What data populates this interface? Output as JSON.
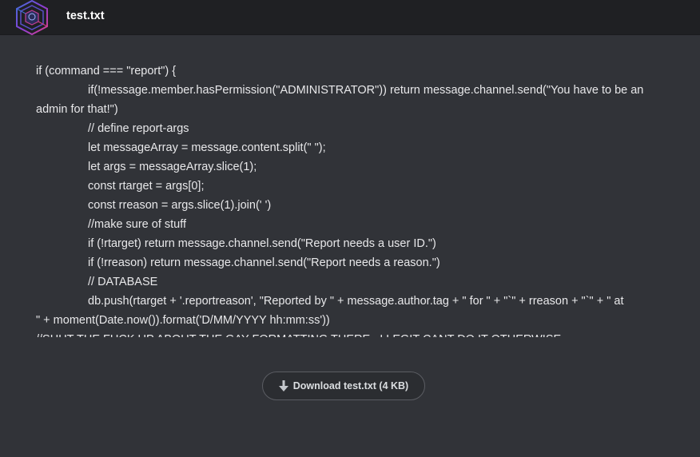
{
  "header": {
    "title": "test.txt",
    "logo_icon": "hexagon-cube-logo"
  },
  "file": {
    "lines": [
      {
        "text": "if (command === \"report\") {",
        "indent": false
      },
      {
        "text": "if(!message.member.hasPermission(\"ADMINISTRATOR\")) return message.channel.send(\"You have to be an",
        "indent": true
      },
      {
        "text": "admin for that!\")",
        "indent": false
      },
      {
        "text": "// define report-args",
        "indent": true
      },
      {
        "text": "let messageArray = message.content.split(\" \");",
        "indent": true
      },
      {
        "text": "let args = messageArray.slice(1);",
        "indent": true
      },
      {
        "text": "const rtarget = args[0];",
        "indent": true
      },
      {
        "text": "const rreason = args.slice(1).join(' ')",
        "indent": true
      },
      {
        "text": "//make sure of stuff",
        "indent": true
      },
      {
        "text": "if (!rtarget) return message.channel.send(\"Report needs a user ID.\")",
        "indent": true
      },
      {
        "text": "if (!rreason) return message.channel.send(\"Report needs a reason.\")",
        "indent": true
      },
      {
        "text": "// DATABASE",
        "indent": true
      },
      {
        "text": "db.push(rtarget + '.reportreason', \"Reported by \" + message.author.tag + \" for \" + \"`\" + rreason + \"`\" + \" at",
        "indent": true
      },
      {
        "text": "\" + moment(Date.now()).format('D/MM/YYYY hh:mm:ss'))",
        "indent": false
      },
      {
        "text": "//SHUT THE FUCK UP ABOUT THE GAY FORMATTING THERE . I LEGIT CANT DO IT OTHERWISE",
        "indent": false
      }
    ]
  },
  "download": {
    "label": "Download test.txt (4 KB)",
    "icon": "arrow-down-icon"
  },
  "colors": {
    "background": "#313338",
    "header_background": "#1f2023",
    "text": "#e8e8ea"
  }
}
